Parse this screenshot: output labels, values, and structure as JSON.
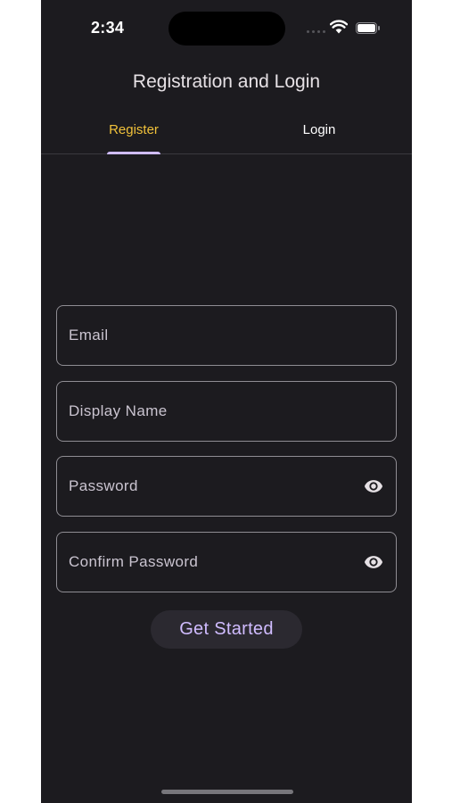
{
  "status_bar": {
    "time": "2:34",
    "icons": [
      "cellular-signal-icon",
      "wifi-icon",
      "battery-icon"
    ]
  },
  "header": {
    "title": "Registration and Login"
  },
  "tabs": [
    {
      "label": "Register",
      "selected": true
    },
    {
      "label": "Login",
      "selected": false
    }
  ],
  "form": {
    "email": {
      "value": "",
      "placeholder": "Email"
    },
    "display_name": {
      "value": "",
      "placeholder": "Display Name"
    },
    "password": {
      "value": "",
      "placeholder": "Password",
      "toggle_icon": "eye-icon"
    },
    "confirm_password": {
      "value": "",
      "placeholder": "Confirm Password",
      "toggle_icon": "eye-icon"
    },
    "submit_label": "Get Started"
  },
  "colors": {
    "background": "#1c1b1f",
    "tab_selected": "#f0c13a",
    "tab_indicator": "#cfbcff",
    "button_text": "#d0bcff",
    "button_bg": "#2b2930",
    "field_border": "#8f8d93"
  }
}
